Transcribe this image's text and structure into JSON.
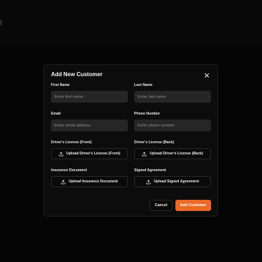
{
  "modal": {
    "title": "Add New Customer",
    "close_icon": "close-icon"
  },
  "fields": {
    "first_name": {
      "label": "First Name",
      "placeholder": "Enter first name",
      "value": ""
    },
    "last_name": {
      "label": "Last Name",
      "placeholder": "Enter last name",
      "value": ""
    },
    "email": {
      "label": "Email",
      "placeholder": "Enter email address",
      "value": ""
    },
    "phone": {
      "label": "Phone Number",
      "placeholder": "Enter phone number",
      "value": ""
    }
  },
  "uploads": {
    "license_front": {
      "label": "Driver's License (Front)",
      "button": "Upload Driver's License (Front)",
      "icon": "upload-icon"
    },
    "license_back": {
      "label": "Driver's License (Back)",
      "button": "Upload Driver's License (Back)",
      "icon": "upload-icon"
    },
    "insurance": {
      "label": "Insurance Document",
      "button": "Upload Insurance Document",
      "icon": "upload-icon"
    },
    "agreement": {
      "label": "Signed Agreement",
      "button": "Upload Signed Agreement",
      "icon": "upload-icon"
    }
  },
  "actions": {
    "cancel_label": "Cancel",
    "submit_label": "Add Customer"
  },
  "colors": {
    "accent": "#ea6a26",
    "background": "#050505",
    "modal_bg": "#0c0c0c",
    "input_bg": "#262626"
  }
}
